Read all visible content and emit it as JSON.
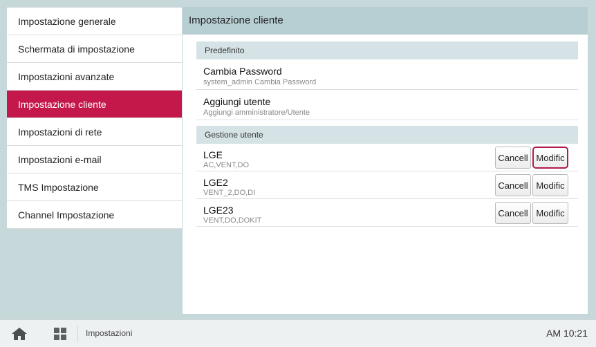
{
  "sidebar": {
    "items": [
      {
        "label": "Impostazione generale"
      },
      {
        "label": "Schermata di impostazione"
      },
      {
        "label": "Impostazioni avanzate"
      },
      {
        "label": "Impostazione cliente",
        "active": true
      },
      {
        "label": "Impostazioni di rete"
      },
      {
        "label": "Impostazioni e-mail"
      },
      {
        "label": "TMS Impostazione"
      },
      {
        "label": "Channel Impostazione"
      }
    ]
  },
  "main": {
    "title": "Impostazione cliente",
    "default_section": {
      "label": "Predefinito",
      "rows": [
        {
          "title": "Cambia Password",
          "sub": "system_admin Cambia Password"
        },
        {
          "title": "Aggiungi utente",
          "sub": "Aggiungi amministratore/Utente"
        }
      ]
    },
    "users_section": {
      "label": "Gestione utente",
      "cancel_label": "Cancell",
      "edit_label": "Modific",
      "users": [
        {
          "name": "LGE",
          "perms": "AC,VENT,DO"
        },
        {
          "name": "LGE2",
          "perms": "VENT_2,DO,DI"
        },
        {
          "name": "LGE23",
          "perms": "VENT,DO,DOKIT"
        }
      ]
    }
  },
  "bottombar": {
    "breadcrumb": "Impostazioni",
    "time": "AM 10:21",
    "icons": [
      "home-icon",
      "grid-icon"
    ]
  },
  "colors": {
    "accent": "#c4184a",
    "header_bg": "#b7cfd3",
    "section_bg": "#d6e3e6",
    "frame_bg": "#c7d8da"
  }
}
